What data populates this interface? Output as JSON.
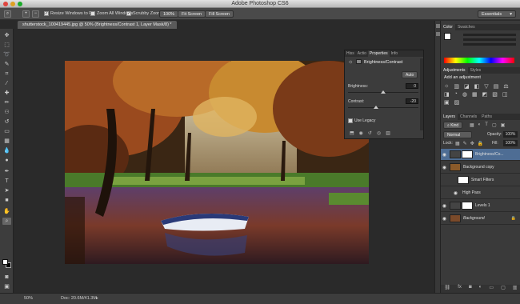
{
  "window": {
    "title": "Adobe Photoshop CS6"
  },
  "options_bar": {
    "resize_windows": "Resize Windows to Fit",
    "zoom_all": "Zoom All Windows",
    "scrubby_zoom": "Scrubby Zoom",
    "zoom_level": "100%",
    "fit_screen": "Fit Screen",
    "fill_screen": "Fill Screen",
    "workspace": "Essentials"
  },
  "document": {
    "tab": "shutterstock_100419445.jpg @ 50% (Brightness/Contrast 1, Layer Mask/8) *"
  },
  "properties": {
    "tabs": [
      "Hiss",
      "Actio",
      "Properties",
      "Info"
    ],
    "title": "Brightness/Contrast",
    "auto": "Auto",
    "brightness_label": "Brightness:",
    "brightness_value": "0",
    "contrast_label": "Contrast:",
    "contrast_value": "-20",
    "legacy": "Use Legacy"
  },
  "panels": {
    "color_tabs": [
      "Color",
      "Swatches"
    ],
    "adjust_tabs": [
      "Adjustments",
      "Styles"
    ],
    "adjust_title": "Add an adjustment",
    "layers_tabs": [
      "Layers",
      "Channels",
      "Paths"
    ],
    "kind": "Kind",
    "blend": "Normal",
    "opacity_label": "Opacity:",
    "opacity": "100%",
    "fill_label": "Fill:",
    "fill": "100%",
    "lock_label": "Lock:"
  },
  "layers": [
    {
      "name": "Brightness/Co...",
      "selected": true
    },
    {
      "name": "Background copy",
      "selected": false
    },
    {
      "name": "Smart Filters",
      "selected": false
    },
    {
      "name": "High Pass",
      "selected": false
    },
    {
      "name": "Levels 1",
      "selected": false
    },
    {
      "name": "Background",
      "selected": false
    }
  ],
  "status": {
    "zoom": "50%",
    "doc": "Doc: 20.6M/41.3M"
  },
  "colors": {
    "accent": "#4e6d94",
    "panel": "#3a3a3a",
    "canvas": "#2a2a2a"
  }
}
